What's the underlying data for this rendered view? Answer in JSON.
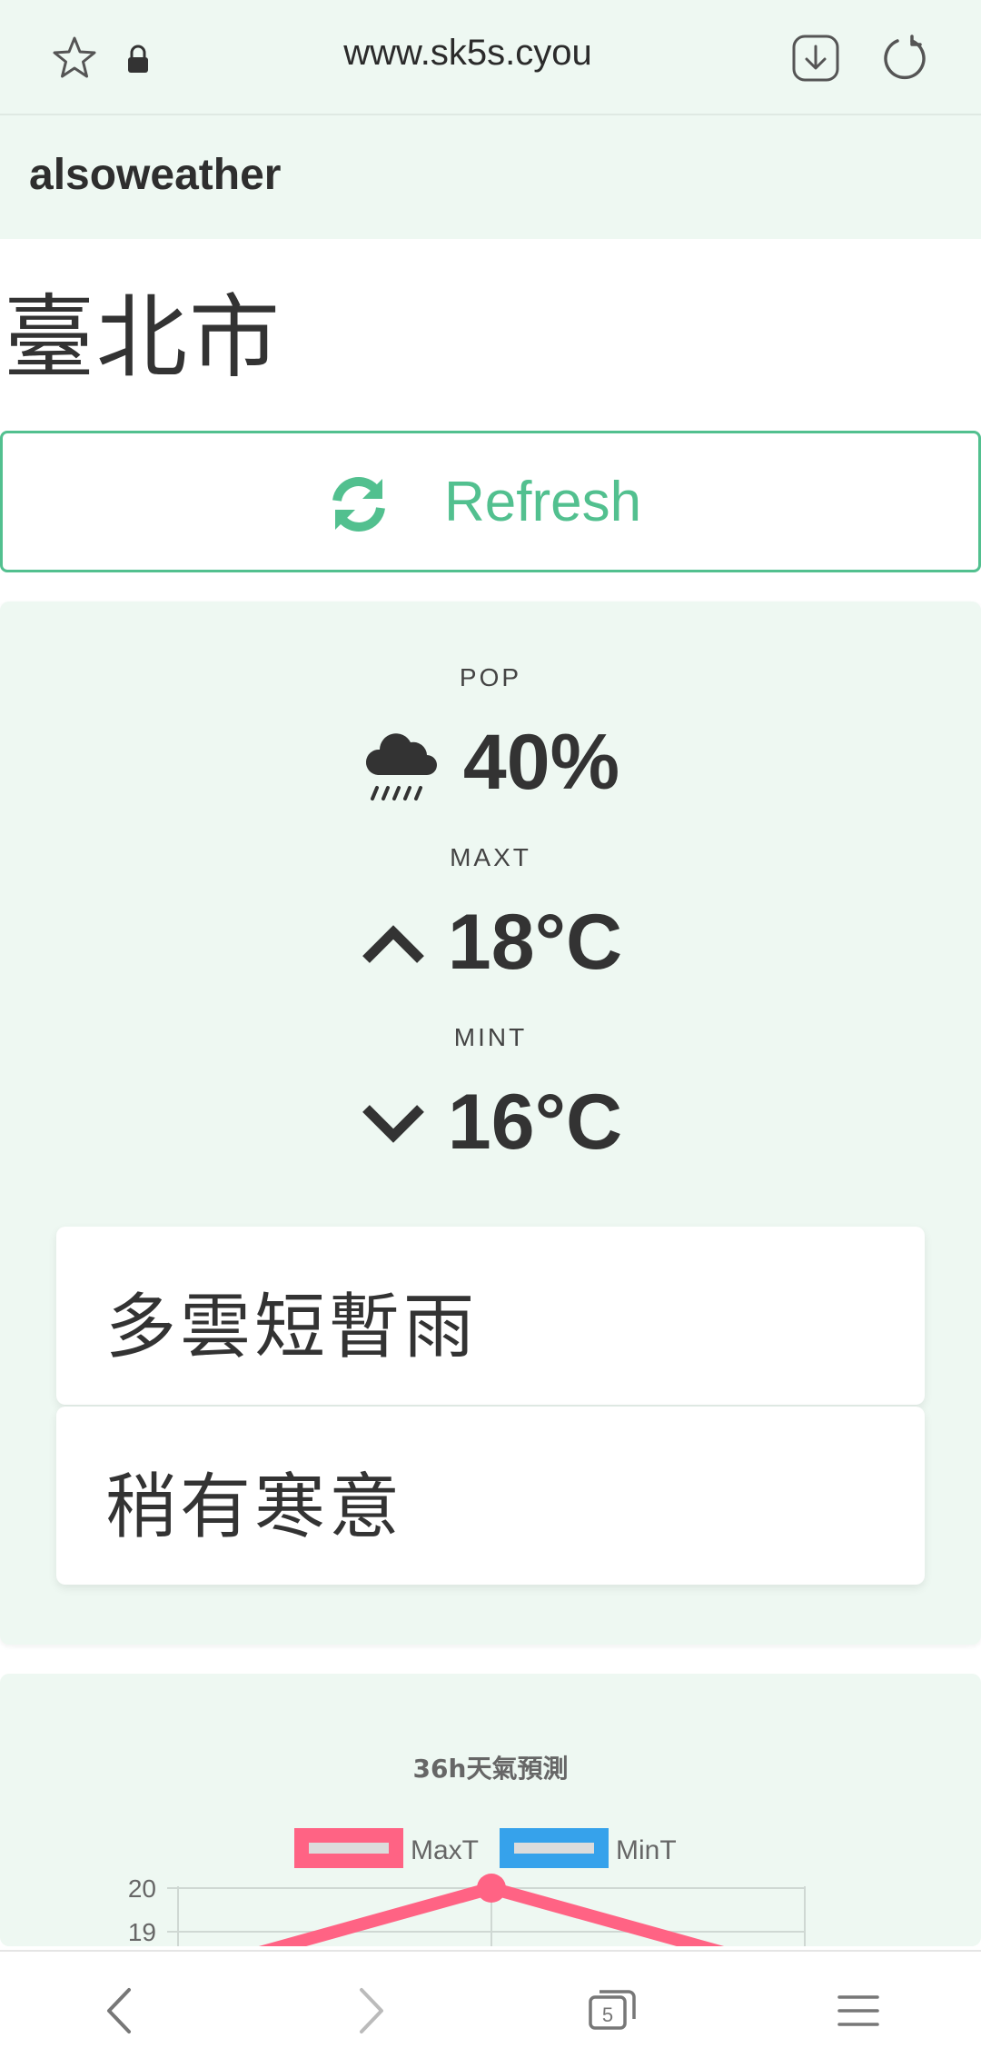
{
  "browser": {
    "url": "www.sk5s.cyou",
    "tab_count": "5"
  },
  "app": {
    "brand": "alsoweather",
    "city": "臺北市",
    "refresh_label": "Refresh"
  },
  "weather": {
    "pop_label": "POP",
    "pop_value": "40%",
    "maxt_label": "MAXT",
    "maxt_value": "18°C",
    "mint_label": "MINT",
    "mint_value": "16°C",
    "descriptions": [
      "多雲短暫雨",
      "稍有寒意"
    ]
  },
  "colors": {
    "accent": "#52c08f",
    "background": "#eef8f2",
    "maxt_series": "#ff6384",
    "mint_series": "#36a2eb"
  },
  "chart_data": {
    "type": "line",
    "title": "36h天氣預測",
    "legend_position": "top",
    "yticks": [
      19,
      20
    ],
    "series": [
      {
        "name": "MaxT",
        "values": [
          18,
          20,
          18
        ]
      },
      {
        "name": "MinT",
        "values": []
      }
    ],
    "grid": true
  }
}
